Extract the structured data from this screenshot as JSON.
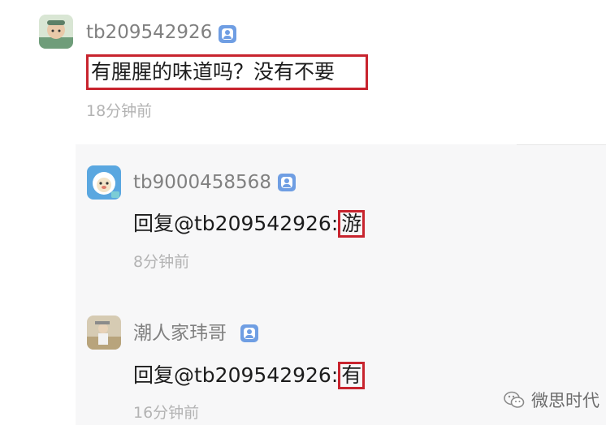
{
  "comments": [
    {
      "username": "tb209542926",
      "text": "有腥腥的味道吗？没有不要",
      "time": "18分钟前"
    }
  ],
  "replies": [
    {
      "username": "tb9000458568",
      "prefix": "回复@tb209542926:",
      "highlight": "游",
      "time": "8分钟前"
    },
    {
      "username": "潮人家玮哥",
      "prefix": "回复@tb209542926:",
      "highlight": "有",
      "time": "16分钟前"
    }
  ],
  "watermark": {
    "text": "微思时代",
    "icon": "wechat-icon"
  },
  "colors": {
    "highlight_border": "#c8242e",
    "badge": "#6f9ee3",
    "username": "#808080",
    "timestamp": "#b3b3b3"
  }
}
